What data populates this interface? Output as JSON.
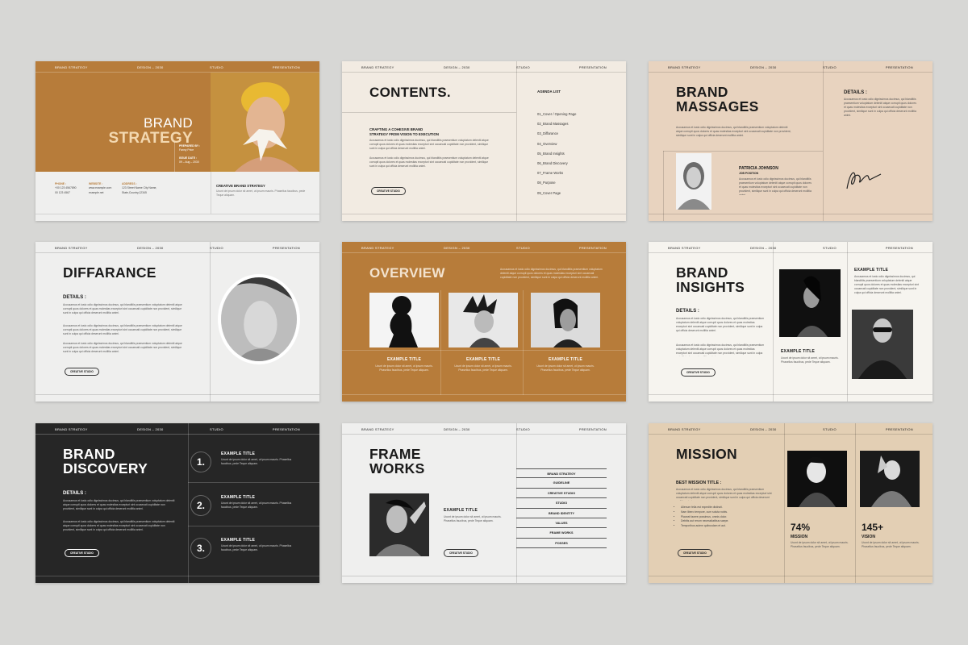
{
  "header": {
    "brand": "BRAND STRATEGY",
    "design": "DESIGN – 2030",
    "studio": "STUDIO",
    "presentation": "PRESENTATION"
  },
  "colors": {
    "mustard": "#b77c3a",
    "cream": "#f2ebe2",
    "beige": "#e8d3bf",
    "offwhite": "#efefee",
    "dark": "#262626",
    "tan": "#e3cfb4"
  },
  "lorem": "Accusamus et iusto odio dignissimos ducimus, qui blanditiis praesentium voluptatum deleniti atque corrupti quos dolores et quas molestias excepturi sint occaecati cupiditate non provident, similique sunt in culpa qui officia deserunt mollitia animi.",
  "lorem_short": "Ucunt de ipsum dolor sit amet, ut ipsum mauris. Phasellus faucibus, pede Teque aliquam.",
  "pill": "CREATIVE STUDIO",
  "s1": {
    "line1": "BRAND",
    "line2": "STRATEGY",
    "prepared_label": "PREPARED BY :",
    "prepared_value": "Fanny Price",
    "issue_label": "ISSUE DATE :",
    "issue_value": "09 – Aug – 2030",
    "phone_label": "PHONE :",
    "phone1": "+00 123 4567890",
    "phone2": "00 123 4567",
    "website_label": "WEBSITE :",
    "website1": "www.example.com",
    "website2": "example.net",
    "address_label": "ADDRESS :",
    "address1": "123 Street Name City Name,",
    "address2": "State,Country,12345",
    "cbs": "CREATIVE BRAND STRATEGY"
  },
  "s2": {
    "title": "CONTENTS.",
    "sub1": "CRAFTING A COHESIVE BRAND",
    "sub2": "STRATEGY FROM VISION TO EXECUTION",
    "agenda_title": "AGENDA LIST",
    "agenda": [
      "01_Cover / Opening Page",
      "02_Brand Massages",
      "03_Diffarance",
      "04_Overview",
      "05_Brand Insights",
      "06_Brand Discovery",
      "07_Frame Works",
      "08_Purpose",
      "09_Cover Page"
    ]
  },
  "s3": {
    "line1": "BRAND",
    "line2": "MASSAGES",
    "details": "DETAILS :",
    "name": "PATRICIA JOHNSON",
    "position": "JOB POSITION"
  },
  "s4": {
    "title": "DIFFARANCE",
    "details": "DETAILS :"
  },
  "s5": {
    "title": "OVERVIEW",
    "items": [
      {
        "title": "EXAMPLE TITLE"
      },
      {
        "title": "EXAMPLE TITLE"
      },
      {
        "title": "EXAMPLE TITLE"
      }
    ]
  },
  "s6": {
    "line1": "BRAND",
    "line2": "INSIGHTS",
    "details": "DETAILS :",
    "ex1": "EXAMPLE TITLE",
    "ex2": "EXAMPLE TITLE"
  },
  "s7": {
    "line1": "BRAND",
    "line2": "DISCOVERY",
    "details": "DETAILS :",
    "items": [
      {
        "num": "1.",
        "title": "EXAMPLE TITLE"
      },
      {
        "num": "2.",
        "title": "EXAMPLE TITLE"
      },
      {
        "num": "3.",
        "title": "EXAMPLE TITLE"
      }
    ]
  },
  "s8": {
    "line1": "FRAME",
    "line2": "WORKS",
    "example": "EXAMPLE TITLE",
    "list": [
      "BRAND STRATEGY",
      "GUIDELINE",
      "CREATIVE STUDIO",
      "STUDIO",
      "BRAND IDENTITY",
      "VALUES",
      "FRAME WORKS",
      "POSSES"
    ]
  },
  "s9": {
    "title": "MISSION",
    "best": "BEST MISSION TITLE :",
    "bullets": [
      "Alienum fella est expedite distincti.",
      "Nam libero tempore, cum soluta nobis.",
      "Placeat facere possimus, omnis dolor.",
      "Debitis aut rerum necessitatibus saepe.",
      "Temporibus autem quibusdam et aut."
    ],
    "stat1": "74%",
    "label1": "MISSION",
    "stat2": "145+",
    "label2": "VISION"
  }
}
